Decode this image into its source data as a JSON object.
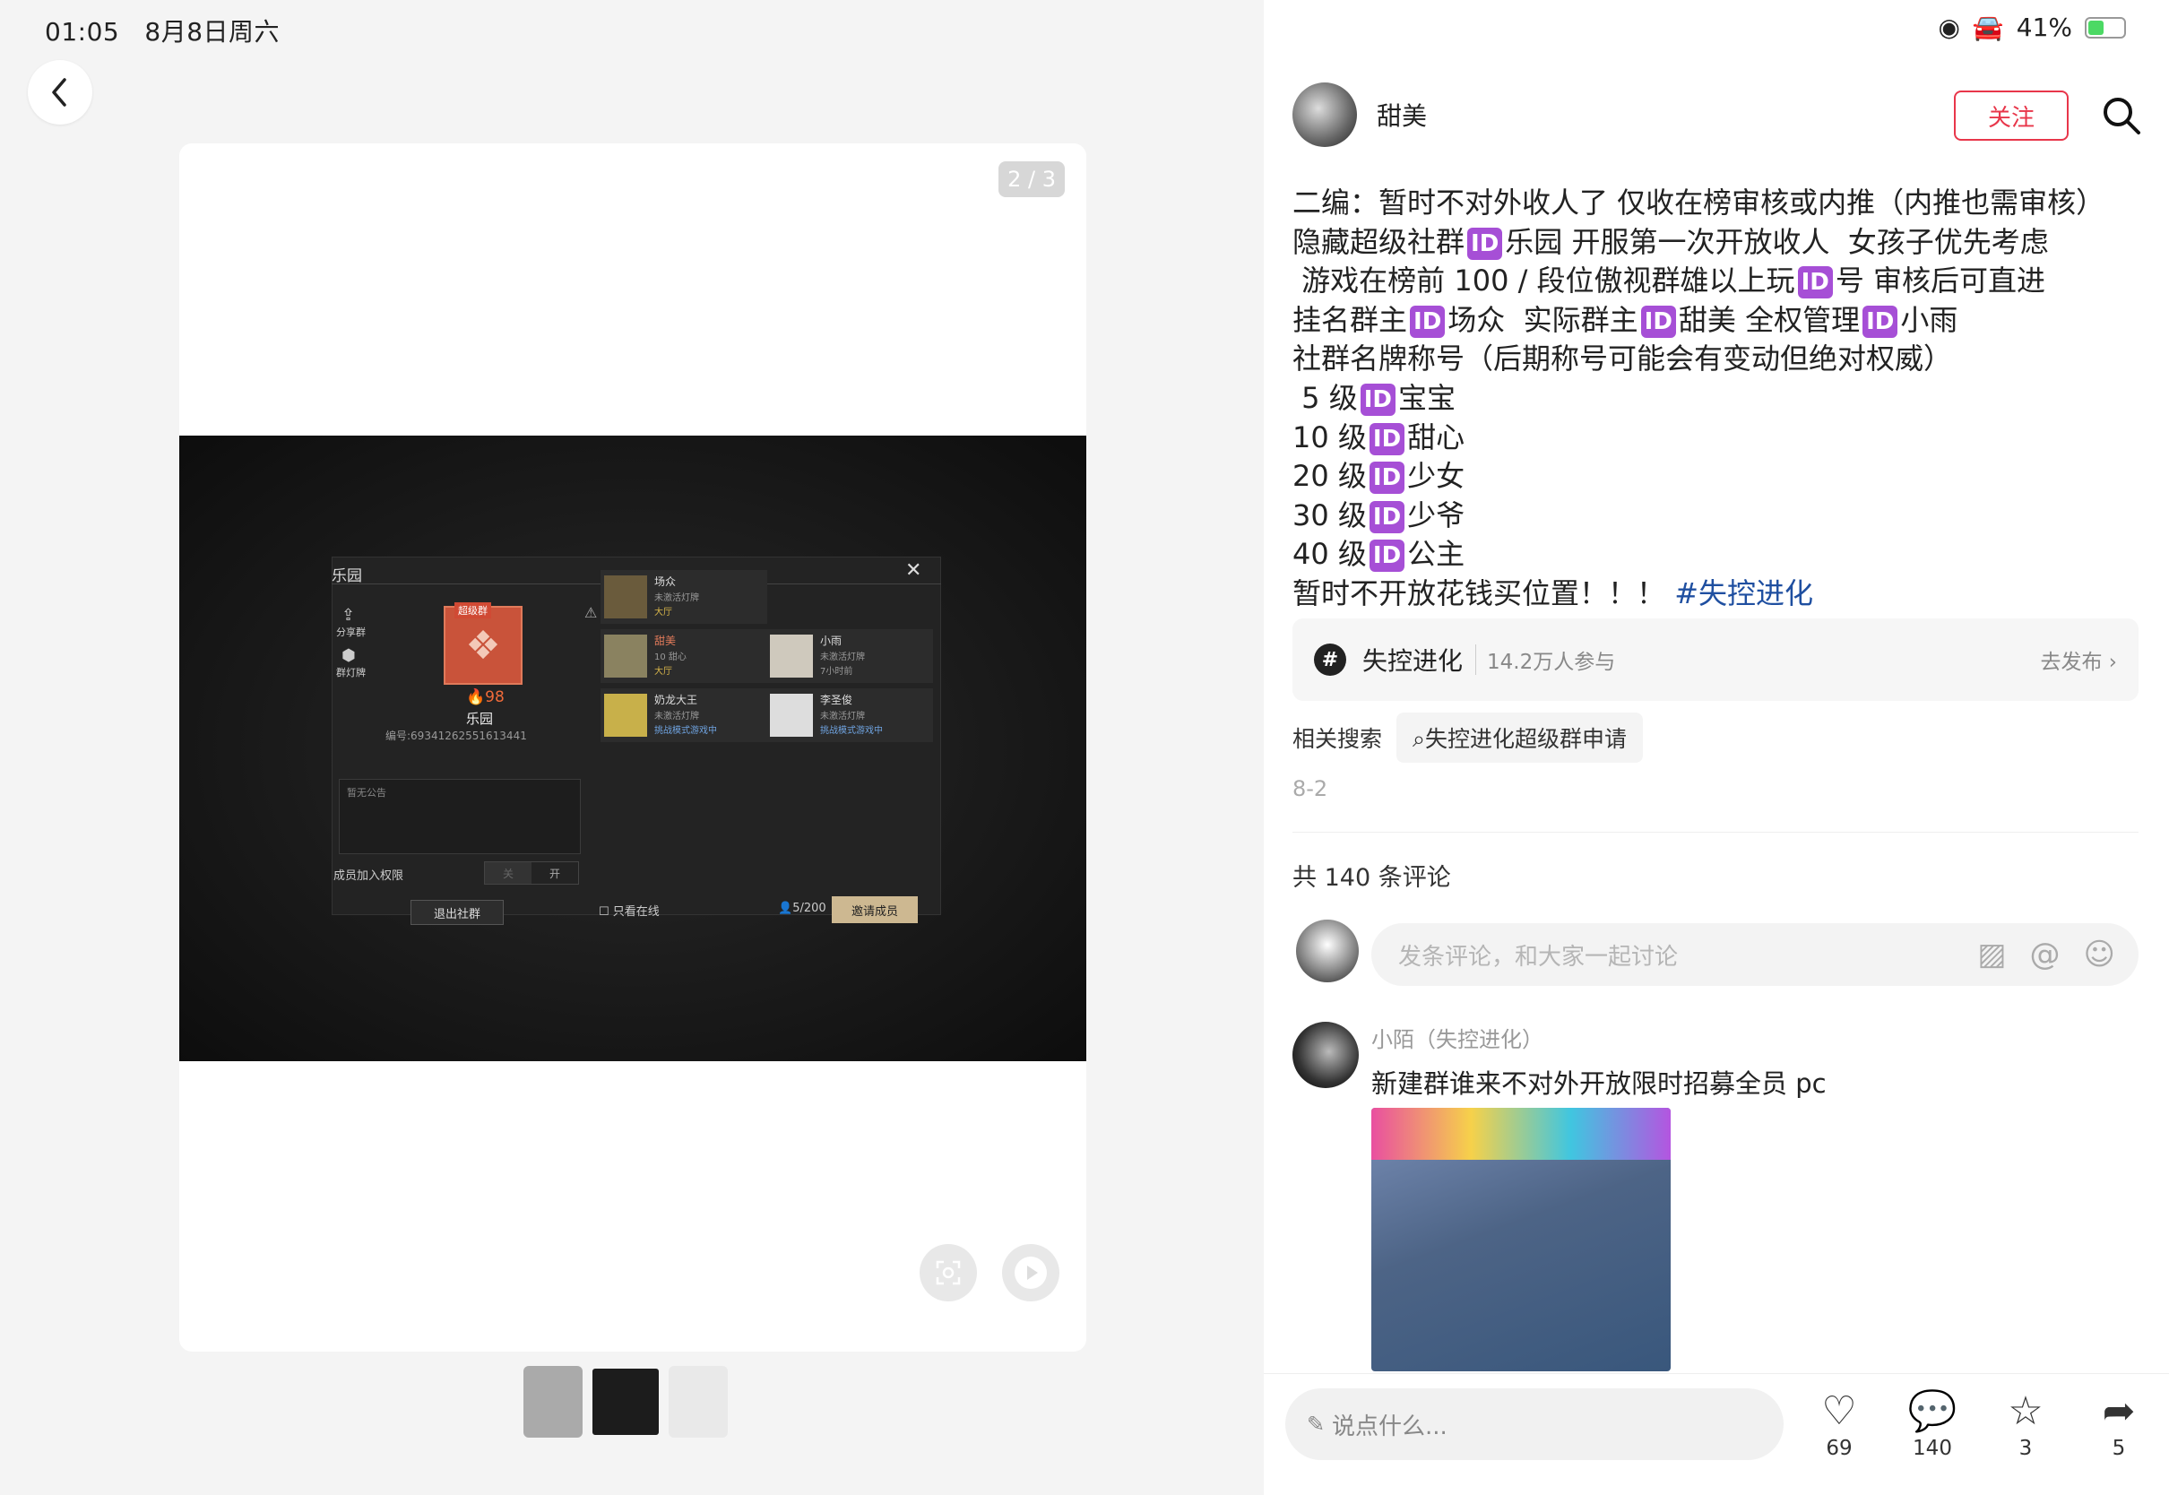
{
  "status": {
    "time": "01:05",
    "date": "8月8日周六",
    "battery": "41%"
  },
  "viewer": {
    "counter": "2 / 3",
    "game": {
      "title": "乐园",
      "badge_tag": "超级群",
      "score": "98",
      "group_name": "乐园",
      "group_id": "编号:69341262551613441",
      "share": "分享群",
      "lamp": "群灯牌",
      "notice": "暂无公告",
      "perm_label": "成员加入权限",
      "toggle_off": "关",
      "toggle_on": "开",
      "exit": "退出社群",
      "members": [
        {
          "name": "场众",
          "status": "未激活灯牌",
          "loc": "大厅"
        },
        {
          "name": "甜美",
          "status": "10 甜心",
          "loc": "大厅"
        },
        {
          "name": "小雨",
          "status": "未激活灯牌",
          "loc": "7小时前"
        },
        {
          "name": "奶龙大王",
          "status": "未激活灯牌",
          "loc": "挑战模式游戏中"
        },
        {
          "name": "李圣俊",
          "status": "未激活灯牌",
          "loc": "挑战模式游戏中"
        }
      ],
      "online_only": "只看在线",
      "count": "5/200",
      "invite": "邀请成员"
    }
  },
  "author": {
    "name": "甜美",
    "follow": "关注"
  },
  "post": {
    "lines": [
      "二编：暂时不对外收人了 仅收在榜审核或内推（内推也需审核）",
      "隐藏超级社群[ID]乐园 开服第一次开放收人  女孩子优先考虑",
      " 游戏在榜前 100 / 段位傲视群雄以上玩[ID]号 审核后可直进",
      "挂名群主[ID]场众  实际群主[ID]甜美 全权管理[ID]小雨",
      "社群名牌称号（后期称号可能会有变动但绝对权威）",
      " 5 级[ID]宝宝",
      "10 级[ID]甜心",
      "20 级[ID]少女",
      "30 级[ID]少爷",
      "40 级[ID]公主",
      "暂时不开放花钱买位置！！！ "
    ],
    "id_badge": "ID",
    "hashtag": "#失控进化"
  },
  "topic": {
    "name": "失控进化",
    "count": "14.2万人参与",
    "action": "去发布"
  },
  "related": {
    "label": "相关搜索",
    "query": "失控进化超级群申请"
  },
  "date": "8-2",
  "comments": {
    "total": "共 140 条评论",
    "placeholder": "发条评论，和大家一起讨论",
    "first": {
      "author": "小陌（失控进化）",
      "text": "新建群谁来不对外开放限时招募全员 pc"
    }
  },
  "bottom": {
    "say": "说点什么...",
    "likes": "69",
    "comments": "140",
    "stars": "3",
    "shares": "5"
  },
  "colors": {
    "accent": "#e8364a",
    "id_badge": "#a64fd6",
    "hashtag": "#1f4fa0"
  }
}
